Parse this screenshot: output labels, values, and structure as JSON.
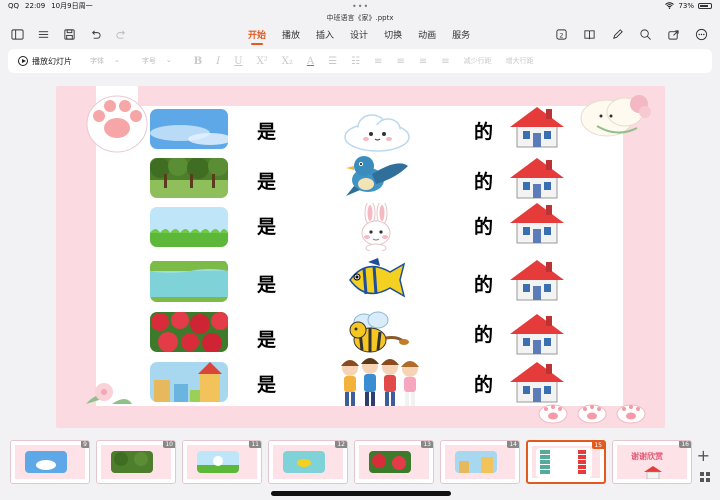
{
  "status": {
    "carrier": "QQ",
    "time": "22:09",
    "date": "10月9日周一",
    "battery": "73%"
  },
  "document": {
    "title": "中班语言《家》.pptx"
  },
  "menu": {
    "tabs": [
      "开始",
      "播放",
      "插入",
      "设计",
      "切换",
      "动画",
      "服务"
    ],
    "active": "开始"
  },
  "ribbon": {
    "play_label": "播放幻灯片",
    "font_placeholder": "字体",
    "size_placeholder": "字号",
    "decrease_spacing": "减少行距",
    "increase_spacing": "增大行距"
  },
  "slide": {
    "rows": [
      {
        "subject": "sky",
        "verb": "是",
        "animal": "cloud",
        "particle": "的"
      },
      {
        "subject": "forest",
        "verb": "是",
        "animal": "bird",
        "particle": "的"
      },
      {
        "subject": "grass",
        "verb": "是",
        "animal": "rabbit",
        "particle": "的"
      },
      {
        "subject": "river",
        "verb": "是",
        "animal": "fish",
        "particle": "的"
      },
      {
        "subject": "flowers",
        "verb": "是",
        "animal": "bee",
        "particle": "的"
      },
      {
        "subject": "town",
        "verb": "是",
        "animal": "children",
        "particle": "的"
      }
    ]
  },
  "thumbnails": [
    {
      "num": "9"
    },
    {
      "num": "10"
    },
    {
      "num": "11"
    },
    {
      "num": "12"
    },
    {
      "num": "13"
    },
    {
      "num": "14"
    },
    {
      "num": "15",
      "active": true
    },
    {
      "num": "16",
      "text": "谢谢欣赏"
    }
  ],
  "colors": {
    "accent": "#e35a1f",
    "slide_bg": "#fbdbe1"
  }
}
